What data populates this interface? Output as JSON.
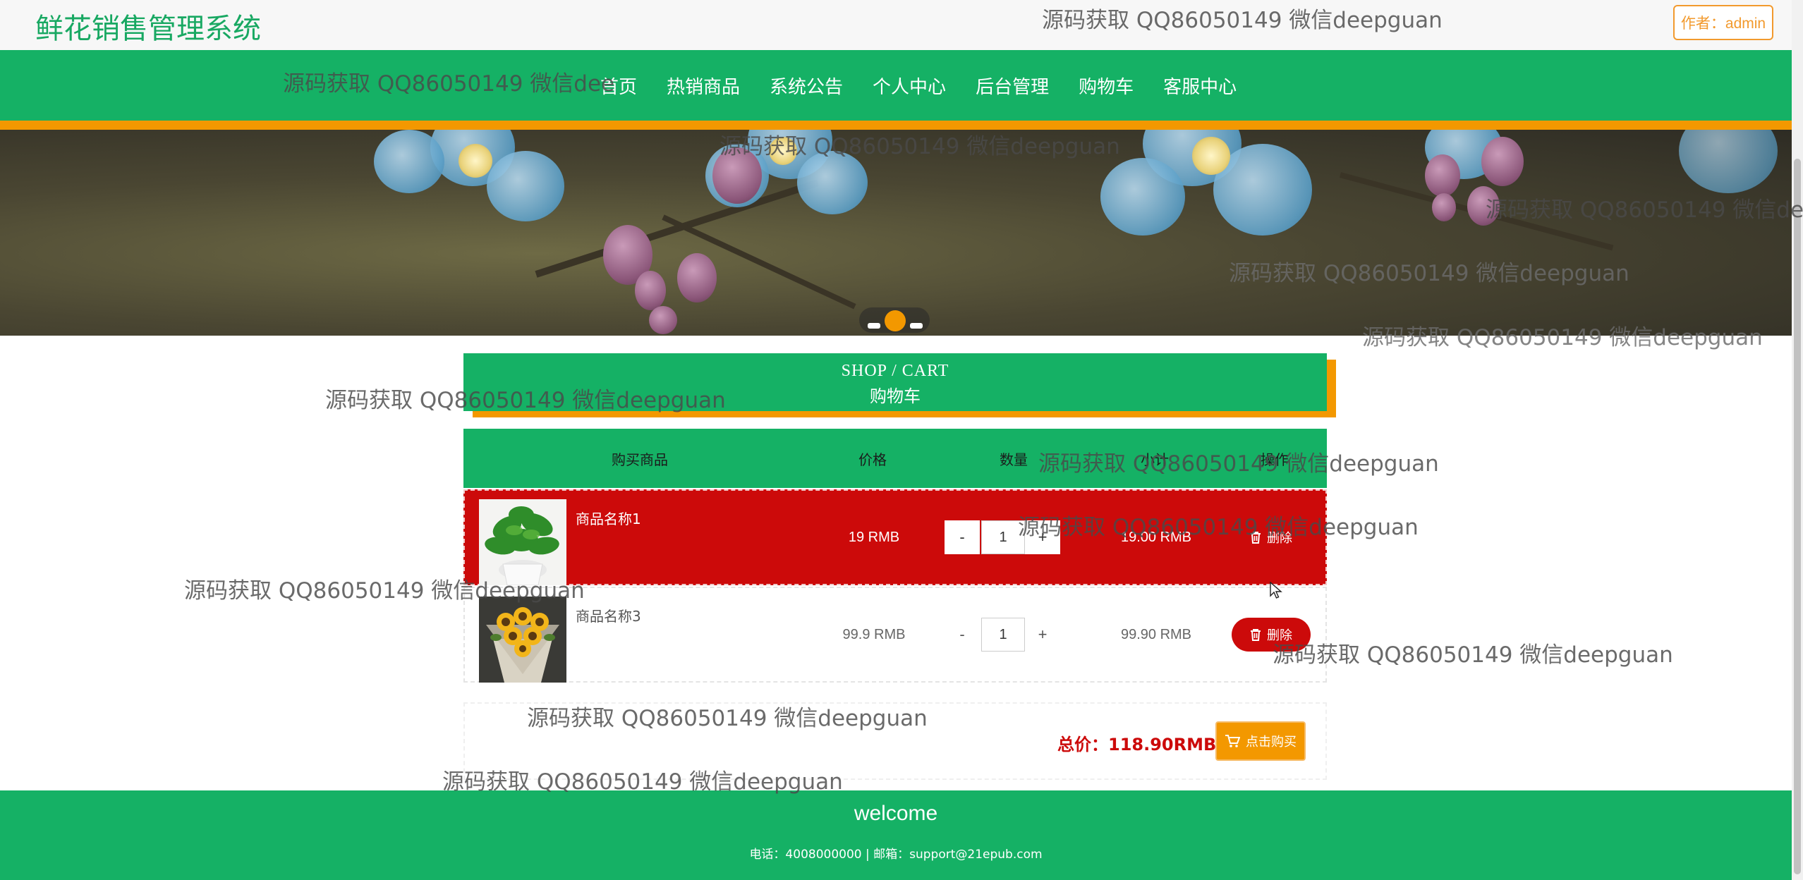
{
  "header": {
    "title": "鲜花销售管理系统",
    "author_label": "作者：admin"
  },
  "nav": {
    "items": [
      "首页",
      "热销商品",
      "系统公告",
      "个人中心",
      "后台管理",
      "购物车",
      "客服中心"
    ]
  },
  "cart_heading": {
    "en": "SHOP / CART",
    "cn": "购物车"
  },
  "table": {
    "headers": [
      "购买商品",
      "价格",
      "数量",
      "小计",
      "操作"
    ],
    "rows": [
      {
        "name": "商品名称1",
        "price": "19 RMB",
        "qty": "1",
        "subtotal": "19.00 RMB",
        "delete_label": "删除",
        "minus": "-",
        "plus": "+"
      },
      {
        "name": "商品名称3",
        "price": "99.9 RMB",
        "qty": "1",
        "subtotal": "99.90 RMB",
        "delete_label": "删除",
        "minus": "-",
        "plus": "+"
      }
    ]
  },
  "summary": {
    "total": "总价：118.90RMB",
    "buy_label": "点击购买"
  },
  "footer": {
    "welcome": "welcome",
    "contact": "电话：4008000000 | 邮箱：support@21epub.com"
  },
  "watermark": "源码获取 QQ86050149 微信deepguan",
  "watermark_partial": "源码获取 QQ86050149 微信dee",
  "colors": {
    "primary_green": "#15b165",
    "accent_orange": "#f39800",
    "active_red": "#cc0a0a"
  },
  "icons": [
    "trash-icon",
    "cart-icon"
  ]
}
